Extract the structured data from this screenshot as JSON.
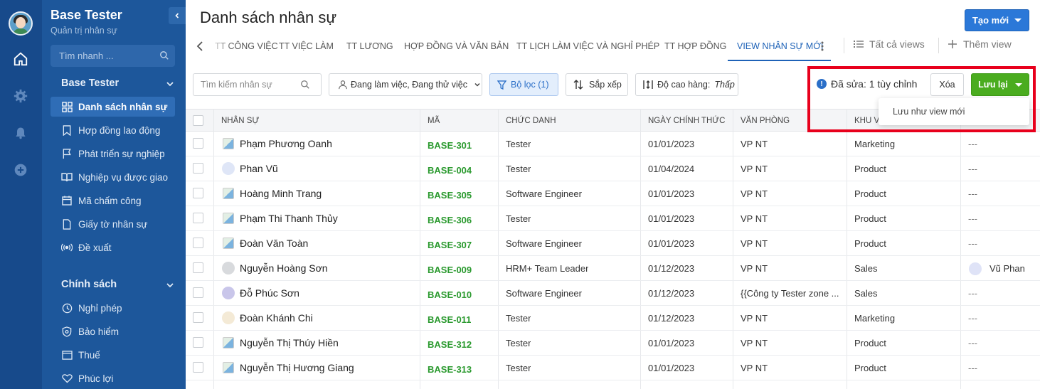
{
  "sidebar": {
    "title": "Base Tester",
    "subtitle": "Quản trị nhân sự",
    "search_placeholder": "Tìm nhanh ...",
    "sections": [
      {
        "label": "Base Tester",
        "items": [
          {
            "label": "Danh sách nhân sự",
            "icon": "grid-icon",
            "active": true
          },
          {
            "label": "Hợp đồng lao động",
            "icon": "bookmark-icon"
          },
          {
            "label": "Phát triển sự nghiệp",
            "icon": "flag-icon"
          },
          {
            "label": "Nghiệp vụ được giao",
            "icon": "book-icon"
          },
          {
            "label": "Mã chấm công",
            "icon": "calendar-icon"
          },
          {
            "label": "Giấy tờ nhân sự",
            "icon": "document-icon"
          },
          {
            "label": "Đề xuất",
            "icon": "broadcast-icon"
          }
        ]
      },
      {
        "label": "Chính sách",
        "items": [
          {
            "label": "Nghỉ phép",
            "icon": "clock-icon"
          },
          {
            "label": "Bảo hiểm",
            "icon": "shield-icon"
          },
          {
            "label": "Thuế",
            "icon": "card-icon"
          },
          {
            "label": "Phúc lợi",
            "icon": "heart-icon"
          }
        ]
      }
    ]
  },
  "header": {
    "title": "Danh sách nhân sự",
    "create_label": "Tạo mới"
  },
  "tabs": {
    "items": [
      {
        "label": "TT CÔNG VIỆC"
      },
      {
        "label": "TT VIỆC LÀM"
      },
      {
        "label": "TT LƯƠNG"
      },
      {
        "label": "HỢP ĐỒNG VÀ VĂN BẢN"
      },
      {
        "label": "TT LỊCH LÀM VIỆC VÀ NGHỈ PHÉP"
      },
      {
        "label": "TT HỢP ĐỒNG"
      },
      {
        "label": "VIEW NHÂN SỰ MỚI",
        "active": true
      }
    ],
    "all_views_label": "Tất cả views",
    "add_view_label": "Thêm view"
  },
  "toolbar": {
    "search_placeholder": "Tìm kiếm nhân sự",
    "status_filter": "Đang làm việc, Đang thử việc",
    "filter_label": "Bộ lọc (1)",
    "sort_label": "Sắp xếp",
    "row_height_label": "Độ cao hàng:",
    "row_height_value": "Thấp",
    "edited_label": "Đã sửa: 1 tùy chỉnh",
    "clear_label": "Xóa",
    "save_label": "Lưu lại",
    "save_as_new_label": "Lưu như view mới"
  },
  "table": {
    "columns": [
      "NHÂN SỰ",
      "MÃ",
      "CHỨC DANH",
      "NGÀY CHÍNH THỨC",
      "VĂN PHÒNG",
      "KHU V"
    ],
    "rows": [
      {
        "name": "Phạm Phương Oanh",
        "avatar": "image",
        "code": "BASE-301",
        "title": "Tester",
        "date": "01/01/2023",
        "office": "VP NT",
        "area": "Marketing",
        "assignee": "---"
      },
      {
        "name": "Phan Vũ",
        "avatar": "#dfe6f7",
        "code": "BASE-004",
        "title": "Tester",
        "date": "01/04/2024",
        "office": "VP NT",
        "area": "Product",
        "assignee": "---"
      },
      {
        "name": "Hoàng Minh Trang",
        "avatar": "image",
        "code": "BASE-305",
        "title": "Software Engineer",
        "date": "01/01/2023",
        "office": "VP NT",
        "area": "Product",
        "assignee": "---"
      },
      {
        "name": "Phạm Thi Thanh Thủy",
        "avatar": "image",
        "code": "BASE-306",
        "title": "Tester",
        "date": "01/01/2023",
        "office": "VP NT",
        "area": "Product",
        "assignee": "---"
      },
      {
        "name": "Đoàn Văn Toàn",
        "avatar": "image",
        "code": "BASE-307",
        "title": "Software Engineer",
        "date": "01/01/2023",
        "office": "VP NT",
        "area": "Product",
        "assignee": "---"
      },
      {
        "name": "Nguyễn Hoàng Sơn",
        "avatar": "#d8dadd",
        "code": "BASE-009",
        "title": "HRM+ Team Leader",
        "date": "01/12/2023",
        "office": "VP NT",
        "area": "Sales",
        "assignee": "Vũ Phan"
      },
      {
        "name": "Đỗ Phúc Sơn",
        "avatar": "#c9c6ea",
        "code": "BASE-010",
        "title": "Software Engineer",
        "date": "01/12/2023",
        "office": "{{Công ty Tester zone ...",
        "area": "Sales",
        "assignee": "---"
      },
      {
        "name": "Đoàn Khánh Chi",
        "avatar": "#f4ead6",
        "code": "BASE-011",
        "title": "Tester",
        "date": "01/12/2023",
        "office": "VP NT",
        "area": "Marketing",
        "assignee": "---"
      },
      {
        "name": "Nguyễn Thị Thúy Hiền",
        "avatar": "image",
        "code": "BASE-312",
        "title": "Tester",
        "date": "01/01/2023",
        "office": "VP NT",
        "area": "Product",
        "assignee": "---"
      },
      {
        "name": "Nguyễn Thị Hương Giang",
        "avatar": "image",
        "code": "BASE-313",
        "title": "Tester",
        "date": "01/01/2023",
        "office": "VP NT",
        "area": "Product",
        "assignee": "---"
      }
    ]
  },
  "colors": {
    "rail_bg": "#174a8b",
    "sidebar_bg": "#1d579b",
    "active_item": "#2f6db6",
    "primary": "#2b78d8",
    "save_green": "#4aac1f",
    "code_green": "#2b9a2f",
    "highlight_red": "#e8001c"
  }
}
